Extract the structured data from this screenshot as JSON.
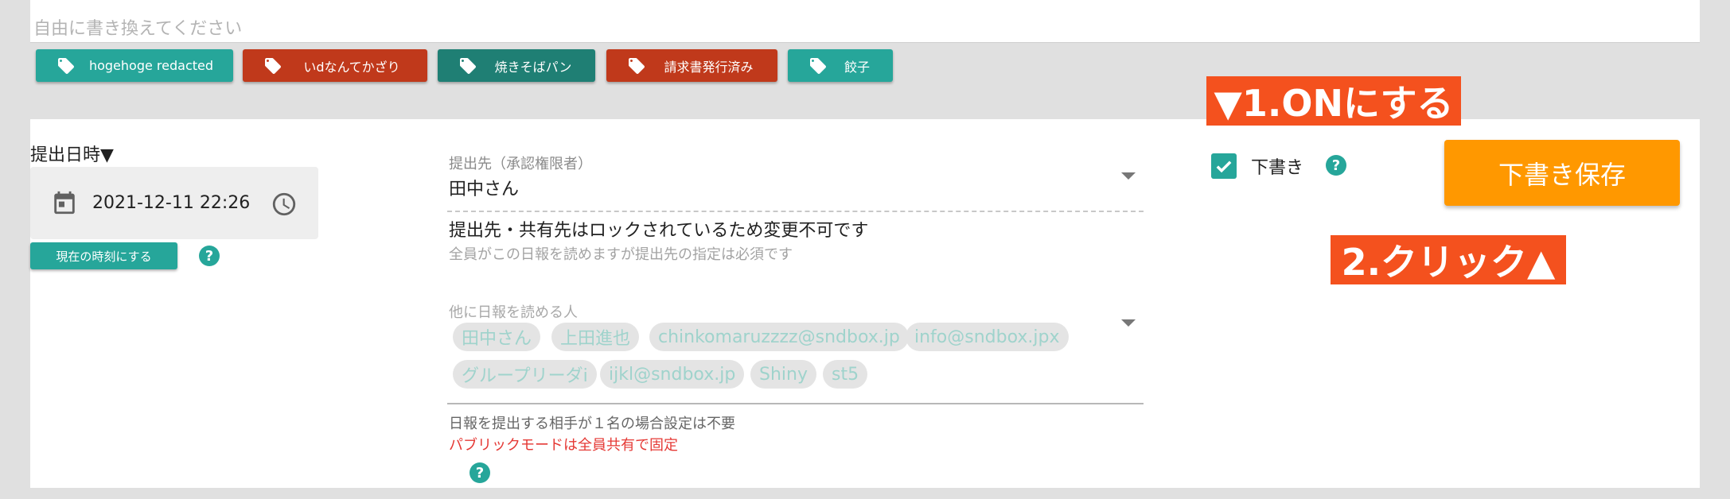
{
  "top_input": {
    "placeholder": "自由に書き換えてください"
  },
  "tags": [
    {
      "label": "hogehoge redacted",
      "color": "#26a69a"
    },
    {
      "label": "いdなんてかざり",
      "color": "#c0391b"
    },
    {
      "label": "焼きそばパン",
      "color": "#1f7f74"
    },
    {
      "label": "請求書発行済み",
      "color": "#c0391b"
    },
    {
      "label": "餃子",
      "color": "#26a69a"
    }
  ],
  "date": {
    "label": "提出日時▼",
    "value": "2021-12-11 22:26",
    "now_button": "現在の時刻にする"
  },
  "recipient": {
    "label": "提出先（承認権限者）",
    "value": "田中さん",
    "lock_text": "提出先・共有先はロックされているため変更不可です",
    "lock_sub": "全員がこの日報を読めますが提出先の指定は必須です"
  },
  "cc": {
    "label": "他に日報を読める人",
    "chips": [
      "田中さん",
      "上田進也",
      "chinkomaruzzzz@sndbox.jp",
      "info@sndbox.jpx",
      "グループリーダi",
      "ijkl@sndbox.jp",
      "Shiny",
      "st5"
    ],
    "note1": "日報を提出する相手が１名の場合設定は不要",
    "note2": "パブリックモードは全員共有で固定"
  },
  "draft": {
    "checkbox_label": "下書き",
    "checked": true,
    "save_button": "下書き保存"
  },
  "annotations": {
    "step1": "▼1.ONにする",
    "step2": "2.クリック▲"
  },
  "help_icon": "?",
  "colors": {
    "accent": "#26a69a",
    "save": "#ff9800",
    "annotation": "#f4511e",
    "warning": "#e53935"
  }
}
